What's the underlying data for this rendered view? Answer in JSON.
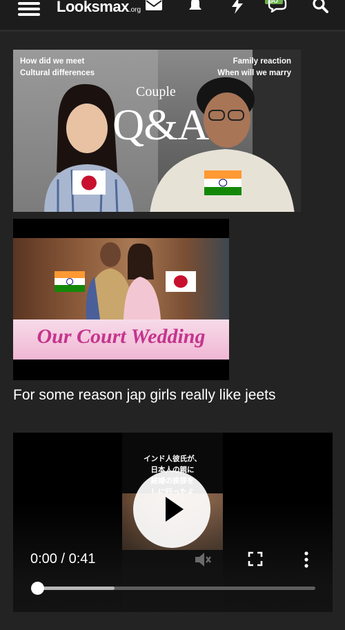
{
  "header": {
    "logo_main": "Looksmax",
    "logo_suffix": ".org",
    "icons": [
      "menu-icon",
      "envelope-icon",
      "bell-icon",
      "lightning-icon",
      "chat-icon",
      "search-icon"
    ],
    "chat_badge": "GO"
  },
  "post": {
    "image1": {
      "caption_left": [
        "How did we meet",
        "Cultural differences"
      ],
      "caption_right": [
        "Family reaction",
        "When will we marry"
      ],
      "subtitle": "Couple",
      "title": "Q&A"
    },
    "image2": {
      "banner": "Our Court Wedding"
    },
    "text": "For some reason jap girls really like jeets",
    "video": {
      "overlay_text": [
        "インド人彼氏が、",
        "日本人の親に",
        "結婚の挨拶を",
        "しに行ったよ"
      ],
      "time": "0:00 / 0:41",
      "progress_buffered": 0.28,
      "progress_played": 0.0
    }
  },
  "colors": {
    "background": "#232323",
    "topbar": "#1c1c1c",
    "badge_green": "#6ab04c",
    "banner_text": "#c4348d"
  }
}
